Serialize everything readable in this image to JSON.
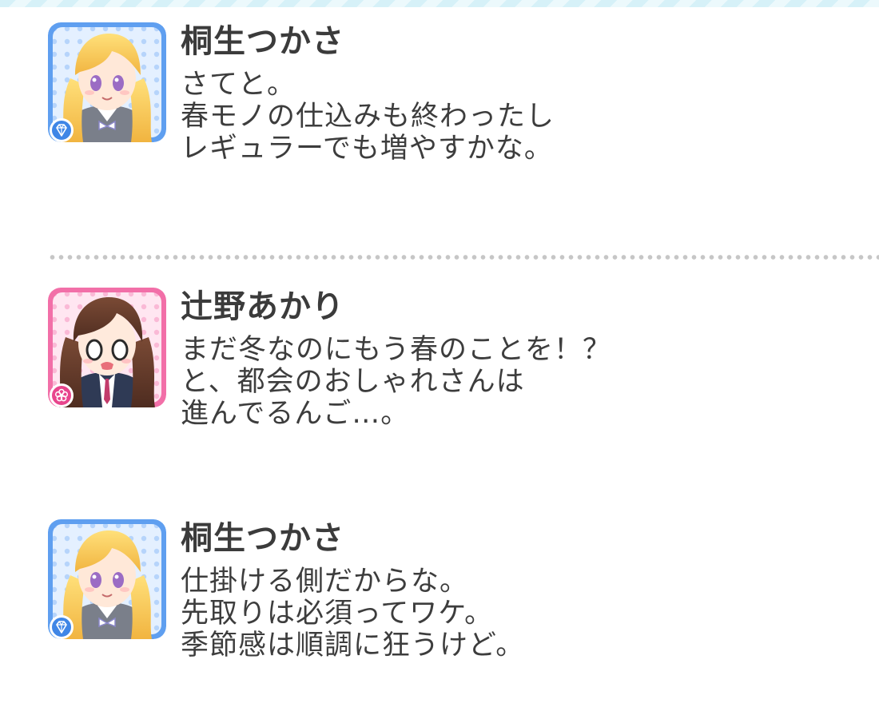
{
  "theme": {
    "blue_frame": "#5f9ff0",
    "blue_frame_dark": "#3e7fe0",
    "pink_frame": "#f26fa8",
    "pink_frame_dark": "#e94a8f",
    "cool_badge": "#3f86e6",
    "cute_badge": "#e8458d",
    "divider_dots": "#c6c6c6"
  },
  "messages": [
    {
      "speaker": "桐生つかさ",
      "avatar_icon": "character-portrait-blonde-icon",
      "badge_icon": "diamond-icon",
      "lines": [
        "さてと。",
        "春モノの仕込みも終わったし",
        "レギュラーでも増やすかな。"
      ]
    },
    {
      "speaker": "辻野あかり",
      "avatar_icon": "character-portrait-brunette-icon",
      "badge_icon": "flower-icon",
      "lines": [
        "まだ冬なのにもう春のことを！？",
        "と、都会のおしゃれさんは",
        "進んでるんご…。"
      ]
    },
    {
      "speaker": "桐生つかさ",
      "avatar_icon": "character-portrait-blonde-icon",
      "badge_icon": "diamond-icon",
      "lines": [
        "仕掛ける側だからな。",
        "先取りは必須ってワケ。",
        "季節感は順調に狂うけど。"
      ]
    }
  ]
}
